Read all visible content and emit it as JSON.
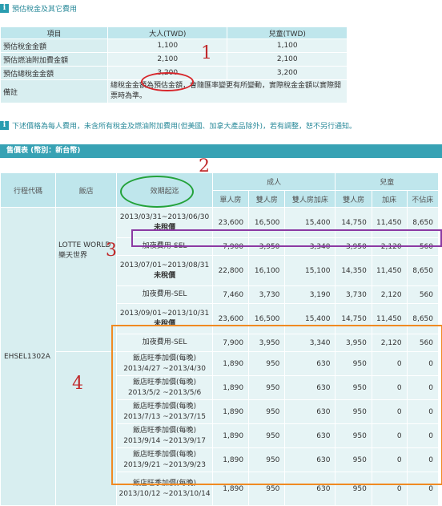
{
  "tax_section": {
    "title": "預估稅金及其它費用",
    "headers": [
      "項目",
      "大人(TWD)",
      "兒童(TWD)"
    ],
    "rows": [
      {
        "label": "預估稅金金額",
        "adult": "1,100",
        "child": "1,100"
      },
      {
        "label": "預估燃油附加費金額",
        "adult": "2,100",
        "child": "2,100"
      },
      {
        "label": "預估總稅金金額",
        "adult": "3,200",
        "child": "3,200"
      }
    ],
    "note_label": "備註",
    "note_text": "總稅金金額為預估金額，會隨匯率變更有所變動，實際稅金金額以實際開票時為準。"
  },
  "notice": "下述價格為每人費用，未含所有稅金及燃油附加費用(但美國、加拿大產品除外)，若有調整，恕不另行通知。",
  "price_section": {
    "bar_title": "售價表 (幣別：新台幣)",
    "headers": {
      "code": "行程代碼",
      "hotel": "飯店",
      "period": "效期起迄",
      "adult": "成人",
      "child": "兒童",
      "adult_cols": [
        "單人房",
        "雙人房",
        "雙人房加床"
      ],
      "child_cols": [
        "雙人房",
        "加床",
        "不佔床"
      ]
    },
    "code": "EHSEL1302A",
    "hotel": "LOTTE WORLD 樂天世界",
    "rows": [
      {
        "period_line1": "2013/03/31~2013/06/30",
        "period_line2": "未稅價",
        "v": [
          "23,600",
          "16,500",
          "15,400",
          "14,750",
          "11,450",
          "8,650"
        ]
      },
      {
        "period_line1": "加夜費用-SEL",
        "period_line2": "",
        "v": [
          "7,900",
          "3,950",
          "3,340",
          "3,950",
          "2,120",
          "560"
        ]
      },
      {
        "period_line1": "2013/07/01~2013/08/31",
        "period_line2": "未稅價",
        "v": [
          "22,800",
          "16,100",
          "15,100",
          "14,350",
          "11,450",
          "8,650"
        ]
      },
      {
        "period_line1": "加夜費用-SEL",
        "period_line2": "",
        "v": [
          "7,460",
          "3,730",
          "3,190",
          "3,730",
          "2,120",
          "560"
        ]
      },
      {
        "period_line1": "2013/09/01~2013/10/31",
        "period_line2": "未稅價",
        "v": [
          "23,600",
          "16,500",
          "15,400",
          "14,750",
          "11,450",
          "8,650"
        ]
      },
      {
        "period_line1": "加夜費用-SEL",
        "period_line2": "",
        "v": [
          "7,900",
          "3,950",
          "3,340",
          "3,950",
          "2,120",
          "560"
        ]
      },
      {
        "period_line1": "飯店旺季加價(每晚)",
        "period_line2": "2013/4/27 ~2013/4/30",
        "v": [
          "1,890",
          "950",
          "630",
          "950",
          "0",
          "0"
        ]
      },
      {
        "period_line1": "飯店旺季加價(每晚)",
        "period_line2": "2013/5/2 ~2013/5/6",
        "v": [
          "1,890",
          "950",
          "630",
          "950",
          "0",
          "0"
        ]
      },
      {
        "period_line1": "飯店旺季加價(每晚)",
        "period_line2": "2013/7/13 ~2013/7/15",
        "v": [
          "1,890",
          "950",
          "630",
          "950",
          "0",
          "0"
        ]
      },
      {
        "period_line1": "飯店旺季加價(每晚)",
        "period_line2": "2013/9/14 ~2013/9/17",
        "v": [
          "1,890",
          "950",
          "630",
          "950",
          "0",
          "0"
        ]
      },
      {
        "period_line1": "飯店旺季加價(每晚)",
        "period_line2": "2013/9/21 ~2013/9/23",
        "v": [
          "1,890",
          "950",
          "630",
          "950",
          "0",
          "0"
        ]
      },
      {
        "period_line1": "飯店旺季加價(每晚)",
        "period_line2": "2013/10/12 ~2013/10/14",
        "v": [
          "1,890",
          "950",
          "630",
          "950",
          "0",
          "0"
        ]
      }
    ]
  },
  "annotations": {
    "n1": "1",
    "n2": "2",
    "n3": "3",
    "n4": "4"
  },
  "colors": {
    "red": "#d7262b",
    "green": "#23a23a",
    "purple": "#8b3aa3",
    "orange": "#f08a22",
    "teal": "#37a2b4"
  }
}
